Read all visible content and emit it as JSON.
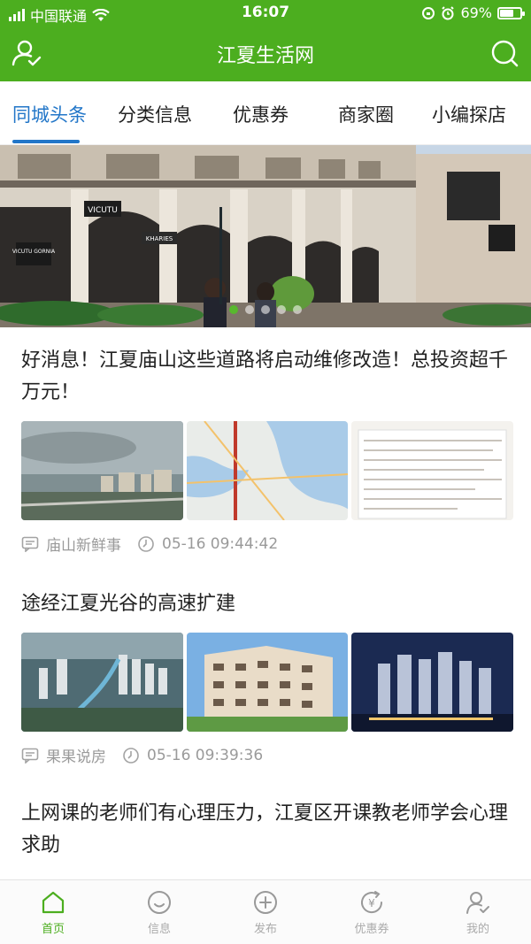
{
  "status_bar": {
    "carrier": "中国联通",
    "time": "16:07",
    "battery_percent": "69%",
    "battery_level": 0.69
  },
  "header": {
    "title": "江夏生活网",
    "left_icon": "user-icon",
    "right_icon": "search-icon",
    "color": "#4cae1f"
  },
  "tabs": [
    {
      "label": "同城头条",
      "active": true
    },
    {
      "label": "分类信息",
      "active": false
    },
    {
      "label": "优惠券",
      "active": false
    },
    {
      "label": "商家圈",
      "active": false
    },
    {
      "label": "小编探店",
      "active": false
    }
  ],
  "banner": {
    "carousel_count": 5,
    "active_index": 0,
    "storefront_signs": [
      "VICUTU",
      "KHARIES",
      "VICUTU GORNIA"
    ]
  },
  "articles": [
    {
      "title": "好消息！江夏庙山这些道路将启动维修改造！总投资超千万元！",
      "source": "庙山新鲜事",
      "time": "05-16 09:44:42"
    },
    {
      "title": "途经江夏光谷的高速扩建",
      "source": "果果说房",
      "time": "05-16 09:39:36"
    },
    {
      "title": "上网课的老师们有心理压力，江夏区开课教老师学会心理求助"
    }
  ],
  "tabbar": [
    {
      "label": "首页",
      "icon": "home-icon",
      "active": true
    },
    {
      "label": "信息",
      "icon": "smile-icon",
      "active": false
    },
    {
      "label": "发布",
      "icon": "plus-circle-icon",
      "active": false
    },
    {
      "label": "优惠券",
      "icon": "coupon-icon",
      "active": false
    },
    {
      "label": "我的",
      "icon": "profile-icon",
      "active": false
    }
  ],
  "colors": {
    "accent": "#4cae1f",
    "tab_active": "#2276c8",
    "meta_gray": "#9a9a9a"
  }
}
